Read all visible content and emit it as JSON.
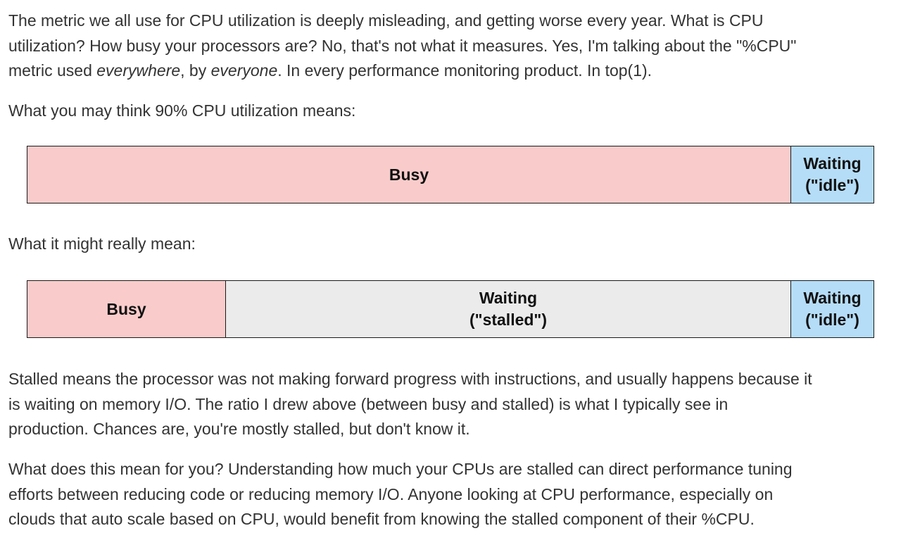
{
  "article": {
    "intro": {
      "line1": "The metric we all use for CPU utilization is deeply misleading, and getting worse every year. What is CPU",
      "line2": "utilization? How busy your processors are? No, that's not what it measures. Yes, I'm talking about the \"%CPU\"",
      "line3_a": "metric used ",
      "line3_em1": "everywhere",
      "line3_b": ", by ",
      "line3_em2": "everyone",
      "line3_c": ". In every performance monitoring product. In top(1)."
    },
    "heading1": "What you may think 90% CPU utilization means:",
    "heading2": "What it might really mean:",
    "stalled_para": {
      "line1": "Stalled means the processor was not making forward progress with instructions, and usually happens because it",
      "line2": "is waiting on memory I/O. The ratio I drew above (between busy and stalled) is what I typically see in",
      "line3": "production. Chances are, you're mostly stalled, but don't know it."
    },
    "meaning_para": {
      "line1": "What does this mean for you? Understanding how much your CPUs are stalled can direct performance tuning",
      "line2": "efforts between reducing code or reducing memory I/O. Anyone looking at CPU performance, especially on",
      "line3": "clouds that auto scale based on CPU, would benefit from knowing the stalled component of their %CPU."
    }
  },
  "diagram1": {
    "busy_percent": 90,
    "idle_percent": 10,
    "busy_label": "Busy",
    "idle_label_line1": "Waiting",
    "idle_label_line2": "(\"idle\")"
  },
  "diagram2": {
    "busy_label": "Busy",
    "stalled_label_line1": "Waiting",
    "stalled_label_line2": "(\"stalled\")",
    "idle_label_line1": "Waiting",
    "idle_label_line2": "(\"idle\")"
  },
  "colors": {
    "busy": "#f9cccb",
    "stalled": "#ebebeb",
    "idle": "#b5ddf7",
    "text": "#333333"
  }
}
